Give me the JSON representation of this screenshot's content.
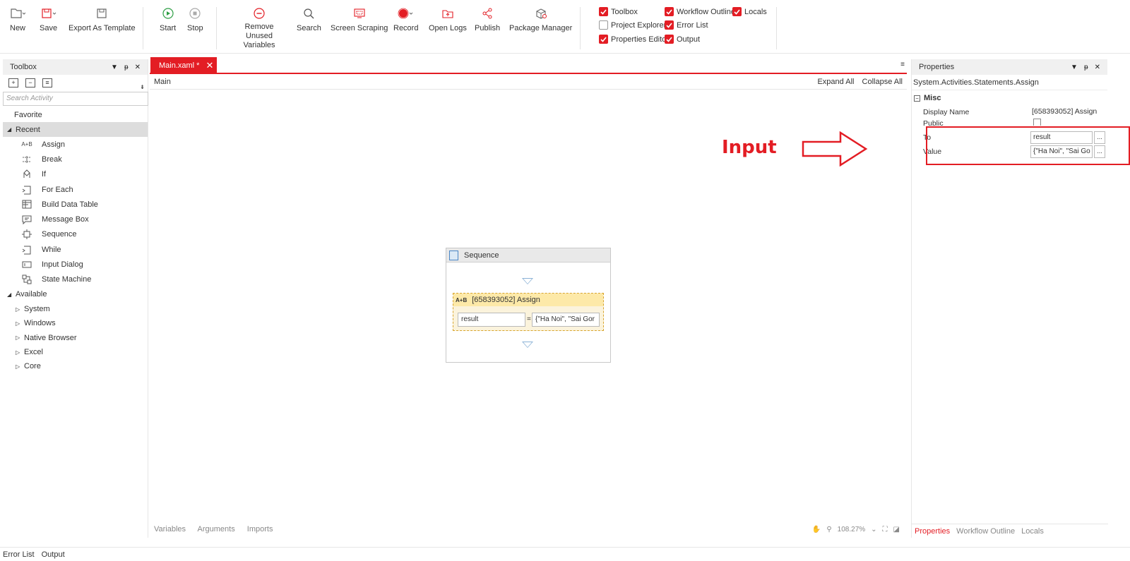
{
  "ribbon": {
    "new": "New",
    "save": "Save",
    "export_template": "Export As Template",
    "start": "Start",
    "stop": "Stop",
    "remove_unused": "Remove Unused Variables",
    "search": "Search",
    "screen_scraping": "Screen Scraping",
    "record": "Record",
    "open_logs": "Open Logs",
    "publish": "Publish",
    "package_manager": "Package Manager",
    "panels": {
      "toolbox": {
        "label": "Toolbox",
        "checked": true
      },
      "project_explorer": {
        "label": "Project Explorer",
        "checked": false
      },
      "properties_editor": {
        "label": "Properties Editor",
        "checked": true
      },
      "workflow_outline": {
        "label": "Workflow Outline",
        "checked": true
      },
      "error_list": {
        "label": "Error List",
        "checked": true
      },
      "output": {
        "label": "Output",
        "checked": true
      },
      "locals": {
        "label": "Locals",
        "checked": true
      }
    },
    "accent": "#e31d24"
  },
  "toolbox": {
    "title": "Toolbox",
    "search_placeholder": "Search Activity",
    "favorite": "Favorite",
    "recent": "Recent",
    "recent_items": [
      "Assign",
      "Break",
      "If",
      "For Each",
      "Build Data Table",
      "Message Box",
      "Sequence",
      "While",
      "Input Dialog",
      "State Machine"
    ],
    "available": "Available",
    "available_groups": [
      "System",
      "Windows",
      "Native Browser",
      "Excel",
      "Core"
    ]
  },
  "designer": {
    "tab": "Main.xaml *",
    "breadcrumb": "Main",
    "expand_all": "Expand All",
    "collapse_all": "Collapse All",
    "sequence_title": "Sequence",
    "assign_title": "[658393052] Assign",
    "assign_icon": "A+B",
    "assign_to": "result",
    "assign_eq": "=",
    "assign_value": "{\"Ha Noi\", \"Sai Gor",
    "bottom_links": [
      "Variables",
      "Arguments",
      "Imports"
    ],
    "zoom": "108.27%"
  },
  "properties": {
    "title": "Properties",
    "type": "System.Activities.Statements.Assign",
    "category": "Misc",
    "display_name_label": "Display Name",
    "display_name_value": "[658393052] Assign",
    "public_label": "Public",
    "to_label": "To",
    "to_value": "result",
    "value_label": "Value",
    "value_value": "{\"Ha Noi\", \"Sai Go",
    "ellipsis": "...",
    "tabs": [
      "Properties",
      "Workflow Outline",
      "Locals"
    ]
  },
  "annotation": {
    "label": "Input"
  },
  "bottom": {
    "error_list": "Error List",
    "output": "Output"
  }
}
